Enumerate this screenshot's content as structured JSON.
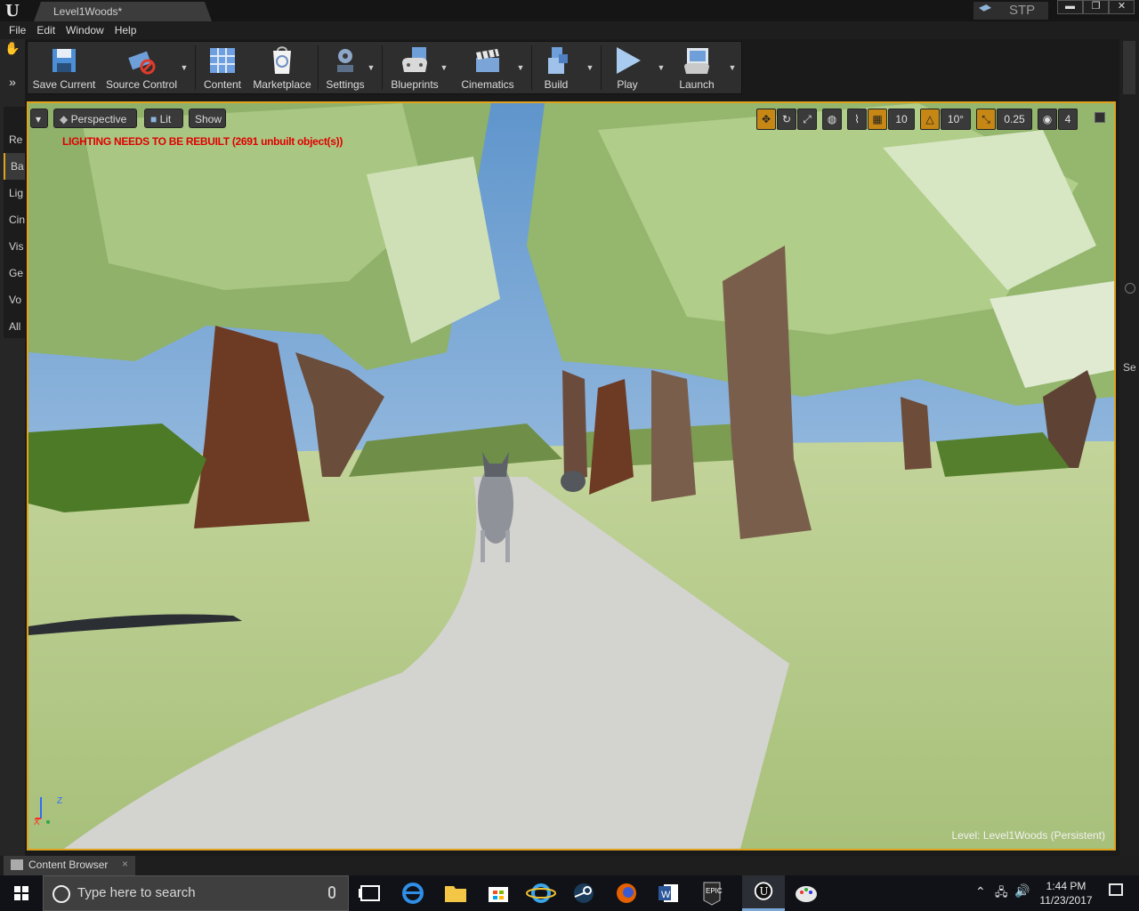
{
  "window": {
    "doc_tab": "Level1Woods*",
    "engine_label": "STP",
    "minimize": "▬",
    "restore": "❐",
    "close": "✕"
  },
  "menu": [
    "File",
    "Edit",
    "Window",
    "Help"
  ],
  "left_tabs": [
    "Re",
    "Ba",
    "Lig",
    "Cin",
    "Vis",
    "Ge",
    "Vo",
    "All"
  ],
  "toolbar": {
    "save_current": "Save Current",
    "source_control": "Source Control",
    "content": "Content",
    "marketplace": "Marketplace",
    "settings": "Settings",
    "blueprints": "Blueprints",
    "cinematics": "Cinematics",
    "build": "Build",
    "play": "Play",
    "launch": "Launch"
  },
  "viewport": {
    "perspective": "Perspective",
    "lit": "Lit",
    "show": "Show",
    "warning": "LIGHTING NEEDS TO BE REBUILT (2691 unbuilt object(s))",
    "grid_snap": "10",
    "rotation_snap": "10°",
    "scale_snap": "0.25",
    "camera_speed": "4",
    "level_label": "Level:  Level1Woods (Persistent)",
    "axis_z": "Z",
    "axis_x": "X"
  },
  "right_rail": {
    "tab": "Se"
  },
  "bottom": {
    "content_browser": "Content Browser",
    "close": "×"
  },
  "taskbar": {
    "search_placeholder": "Type here to search",
    "time": "1:44 PM",
    "date": "11/23/2017"
  }
}
